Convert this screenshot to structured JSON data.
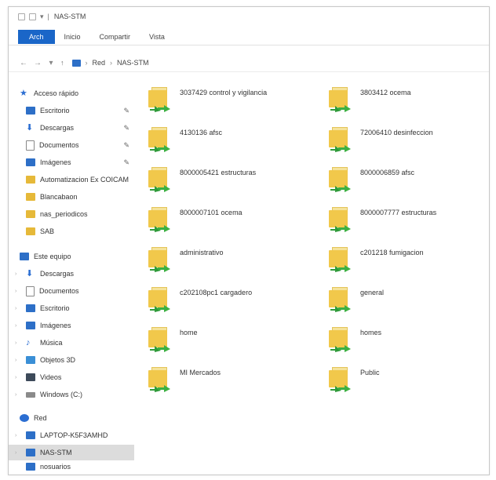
{
  "window": {
    "title": "NAS-STM"
  },
  "ribbon": {
    "tabs": [
      "Inicio",
      "Compartir",
      "Vista"
    ],
    "file_tab": "Arch"
  },
  "address": {
    "crumbs": [
      "Red",
      "NAS-STM"
    ]
  },
  "sidebar": {
    "quick_access": "Acceso rápido",
    "items": [
      {
        "label": "Escritorio",
        "icon": "desktop-icon",
        "pinned": true
      },
      {
        "label": "Descargas",
        "icon": "download-icon",
        "pinned": true
      },
      {
        "label": "Documentos",
        "icon": "document-icon",
        "pinned": true
      },
      {
        "label": "Imágenes",
        "icon": "image-icon",
        "pinned": true
      },
      {
        "label": "Automatizacion Ex COICAM",
        "icon": "folder-icon"
      },
      {
        "label": "Blancabaon",
        "icon": "folder-icon"
      },
      {
        "label": "nas_periodicos",
        "icon": "folder-icon"
      },
      {
        "label": "SAB",
        "icon": "folder-icon"
      }
    ],
    "this_pc": "Este equipo",
    "pc_items": [
      {
        "label": "Descargas",
        "icon": "download-icon"
      },
      {
        "label": "Documentos",
        "icon": "document-icon"
      },
      {
        "label": "Escritorio",
        "icon": "desktop-icon"
      },
      {
        "label": "Imágenes",
        "icon": "image-icon"
      },
      {
        "label": "Música",
        "icon": "music-icon"
      },
      {
        "label": "Objetos 3D",
        "icon": "3d-objects-icon"
      },
      {
        "label": "Videos",
        "icon": "video-icon"
      },
      {
        "label": "Windows (C:)",
        "icon": "drive-icon"
      }
    ],
    "network": "Red",
    "net_items": [
      {
        "label": "LAPTOP-K5F3AMHD",
        "icon": "computer-icon"
      },
      {
        "label": "NAS-STM",
        "icon": "computer-icon",
        "selected": true
      },
      {
        "label": "nosuarios",
        "icon": "computer-icon"
      }
    ]
  },
  "folders": [
    "3037429 control y vigilancia",
    "3803412 ocema",
    "4130136 afsc",
    "72006410 desinfeccion",
    "8000005421 estructuras",
    "8000006859 afsc",
    "8000007101 ocema",
    "8000007777 estructuras",
    "administrativo",
    "c201218 fumigacion",
    "c202108pc1 cargadero",
    "general",
    "home",
    "homes",
    "MI Mercados",
    "Public"
  ]
}
